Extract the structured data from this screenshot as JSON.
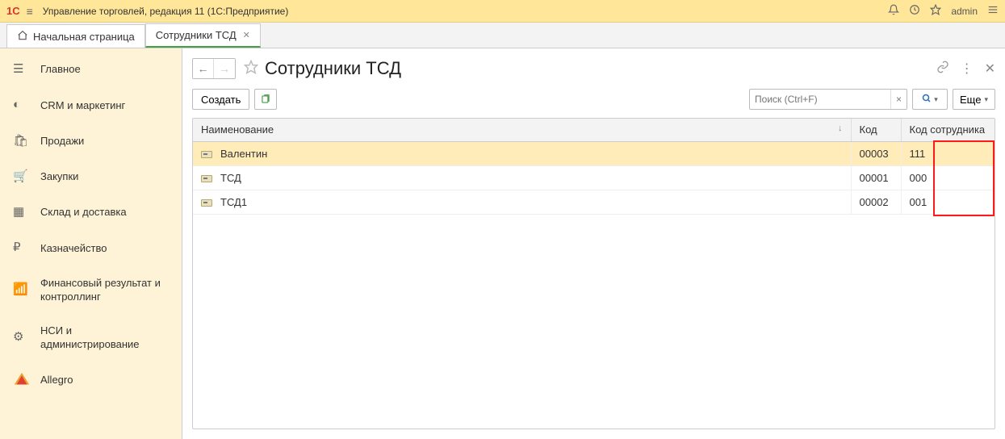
{
  "titlebar": {
    "logo": "1С",
    "title": "Управление торговлей, редакция 11  (1С:Предприятие)",
    "user": "admin"
  },
  "tabs": {
    "home": "Начальная страница",
    "active": "Сотрудники ТСД"
  },
  "sidebar": {
    "items": [
      {
        "icon": "bars-icon",
        "glyph": "☰",
        "label": "Главное"
      },
      {
        "icon": "pie-icon",
        "glyph": "◐",
        "label": "CRM и маркетинг"
      },
      {
        "icon": "bag-icon",
        "glyph": "🛍",
        "label": "Продажи"
      },
      {
        "icon": "cart-icon",
        "glyph": "🛒",
        "label": "Закупки"
      },
      {
        "icon": "grid-icon",
        "glyph": "▦",
        "label": "Склад и доставка"
      },
      {
        "icon": "ruble-icon",
        "glyph": "₽",
        "label": "Казначейство"
      },
      {
        "icon": "chart-icon",
        "glyph": "📶",
        "label": "Финансовый результат и контроллинг"
      },
      {
        "icon": "gear-icon",
        "glyph": "⚙",
        "label": "НСИ и администрирование"
      },
      {
        "icon": "allegro-icon",
        "glyph": "",
        "label": "Allegro"
      }
    ]
  },
  "page": {
    "title": "Сотрудники ТСД"
  },
  "toolbar": {
    "create_label": "Создать",
    "more_label": "Еще"
  },
  "search": {
    "placeholder": "Поиск (Ctrl+F)"
  },
  "table": {
    "columns": {
      "name": "Наименование",
      "code": "Код",
      "emp_code": "Код сотрудника"
    },
    "rows": [
      {
        "name": "Валентин",
        "code": "00003",
        "emp_code": "111",
        "selected": true
      },
      {
        "name": "ТСД",
        "code": "00001",
        "emp_code": "000",
        "selected": false
      },
      {
        "name": "ТСД1",
        "code": "00002",
        "emp_code": "001",
        "selected": false
      }
    ]
  }
}
